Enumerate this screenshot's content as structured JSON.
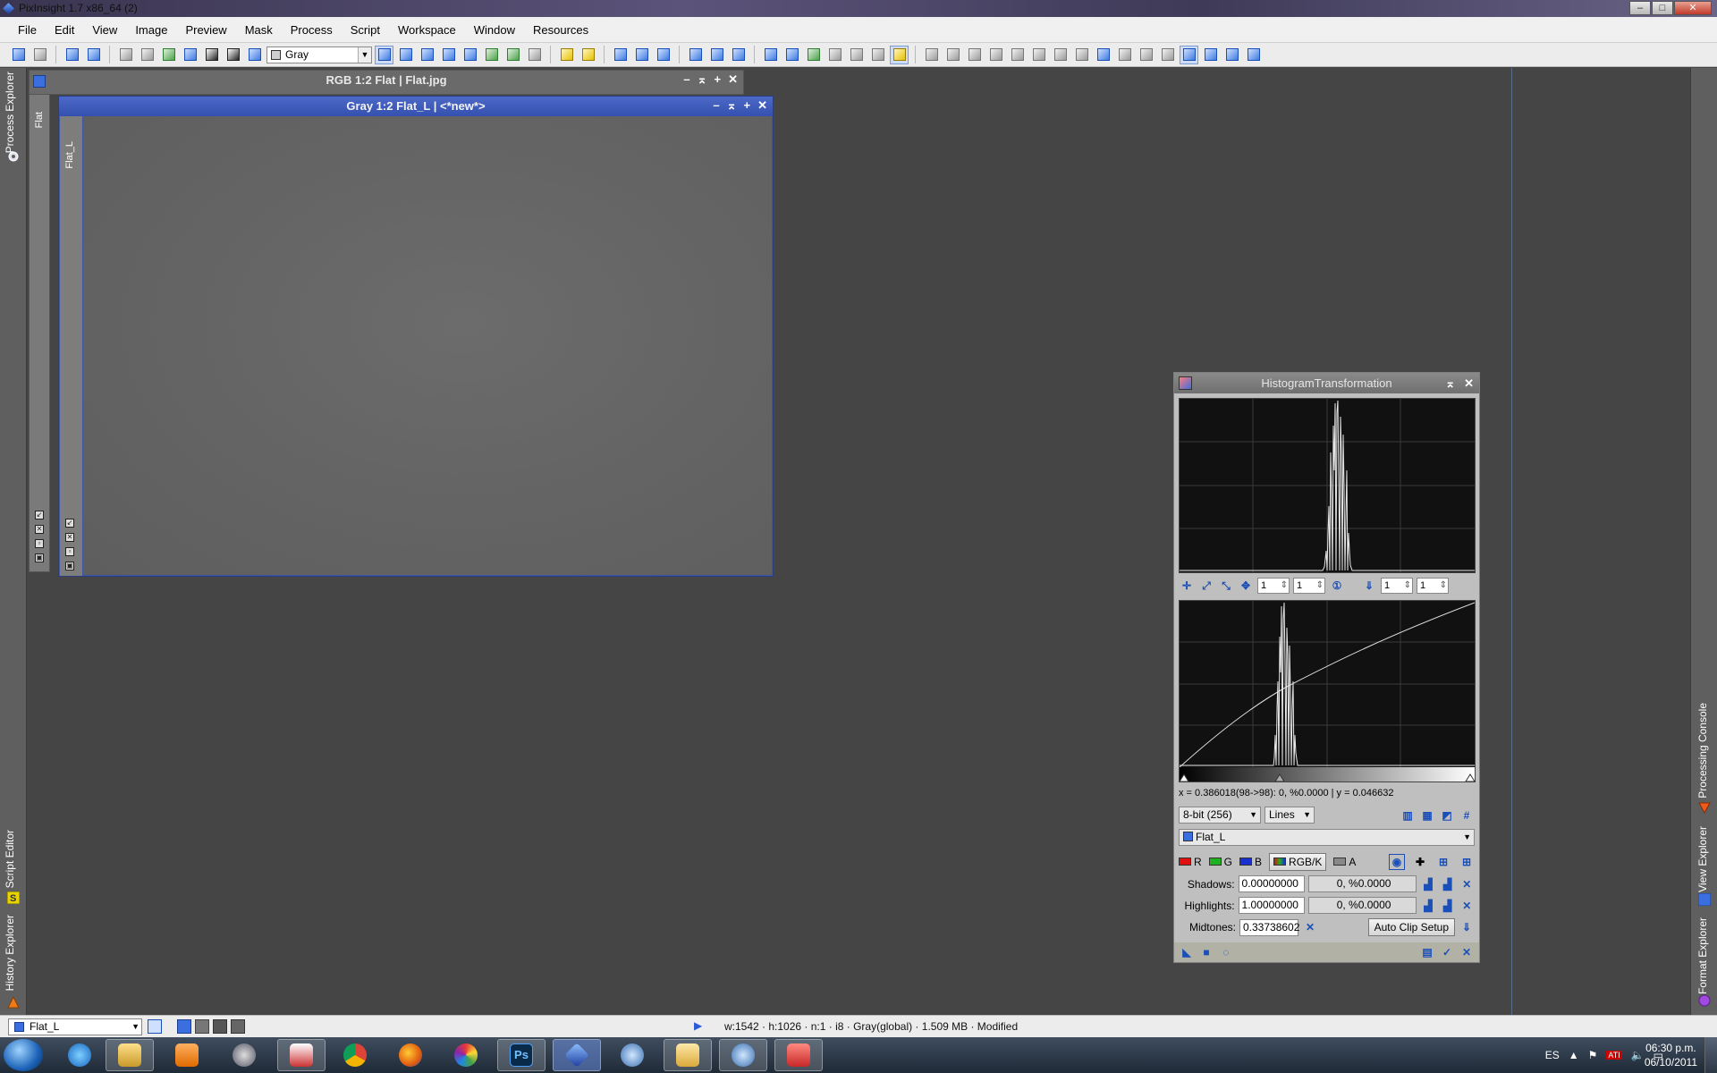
{
  "app": {
    "title": "PixInsight 1.7 x86_64 (2)"
  },
  "menu": [
    "File",
    "Edit",
    "View",
    "Image",
    "Preview",
    "Mask",
    "Process",
    "Script",
    "Workspace",
    "Window",
    "Resources"
  ],
  "toolbar": {
    "colorspace_value": "Gray"
  },
  "left_panel": {
    "tabs": [
      "Process Explorer",
      "Script Editor",
      "History Explorer"
    ]
  },
  "right_panel": {
    "tabs": [
      "Processing Console",
      "View Explorer",
      "Format Explorer"
    ]
  },
  "windows": {
    "back": {
      "title": "RGB 1:2 Flat | Flat.jpg",
      "side_label": "Flat"
    },
    "front": {
      "title": "Gray 1:2 Flat_L | <*new*>",
      "side_label": "Flat_L"
    }
  },
  "histogram": {
    "title": "HistogramTransformation",
    "zoom_h": "1",
    "zoom_v": "1",
    "scroll_h": "1",
    "scroll_v": "1",
    "readout": "x = 0.386018(98->98): 0, %0.0000 | y = 0.046632",
    "resolution": "8-bit (256)",
    "plot_mode": "Lines",
    "view": "Flat_L",
    "channels": {
      "r": "R",
      "g": "G",
      "b": "B",
      "rgbk": "RGB/K",
      "a": "A"
    },
    "channel_colors": {
      "r": "#e01010",
      "g": "#20b020",
      "b": "#1a2fd0"
    },
    "shadows_label": "Shadows:",
    "shadows_value": "0.00000000",
    "shadows_clip": "0, %0.0000",
    "highlights_label": "Highlights:",
    "highlights_value": "1.00000000",
    "highlights_clip": "0, %0.0000",
    "midtones_label": "Midtones:",
    "midtones_value": "0.33738602",
    "auto_clip_label": "Auto Clip Setup"
  },
  "statusbar": {
    "view": "Flat_L",
    "info": "w:1542 · h:1026 · n:1 · i8 · Gray(global) · 1.509 MB · Modified"
  },
  "taskbar": {
    "lang": "ES",
    "time": "06:30 p.m.",
    "date": "06/10/2011"
  }
}
